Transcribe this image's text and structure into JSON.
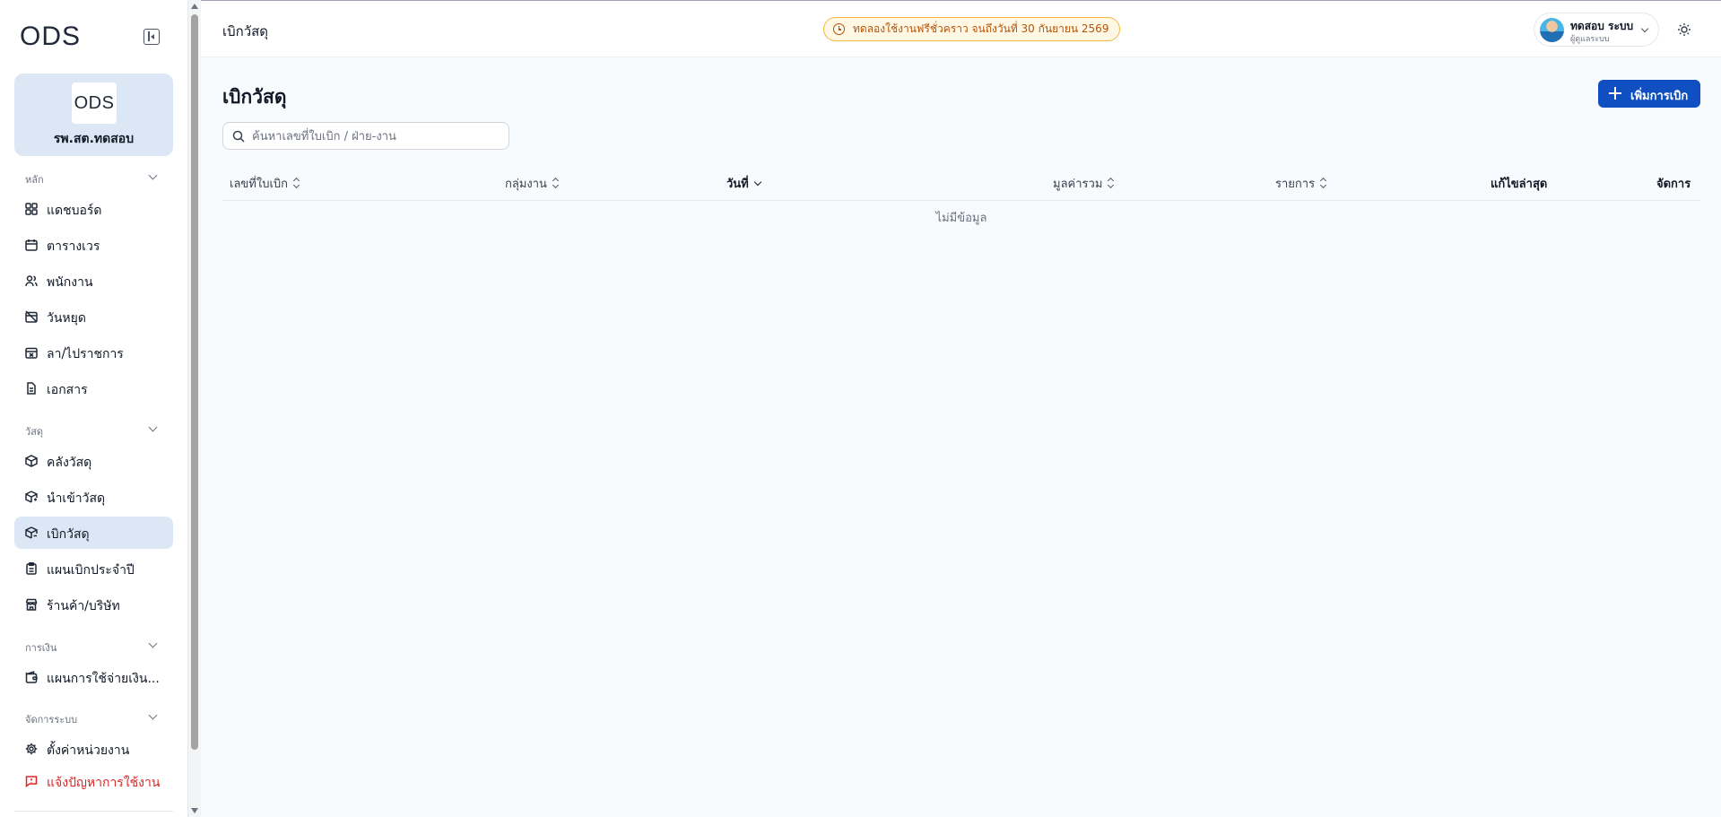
{
  "brand": {
    "logo_text": "ODS",
    "org_name": "รพ.สต.ทดสอบ"
  },
  "sidebar": {
    "sections": [
      {
        "title": "หลัก",
        "items": [
          {
            "label": "แดชบอร์ด",
            "icon": "dashboard-icon"
          },
          {
            "label": "ตารางเวร",
            "icon": "calendar-icon"
          },
          {
            "label": "พนักงาน",
            "icon": "users-icon"
          },
          {
            "label": "วันหยุด",
            "icon": "calendar-off-icon"
          },
          {
            "label": "ลา/ไปราชการ",
            "icon": "calendar-x-icon"
          },
          {
            "label": "เอกสาร",
            "icon": "document-icon"
          }
        ]
      },
      {
        "title": "วัสดุ",
        "items": [
          {
            "label": "คลังวัสดุ",
            "icon": "package-icon"
          },
          {
            "label": "นำเข้าวัสดุ",
            "icon": "package-import-icon"
          },
          {
            "label": "เบิกวัสดุ",
            "icon": "package-withdraw-icon",
            "active": true
          },
          {
            "label": "แผนเบิกประจำปี",
            "icon": "clipboard-icon"
          },
          {
            "label": "ร้านค้า/บริษัท",
            "icon": "store-icon"
          }
        ]
      },
      {
        "title": "การเงิน",
        "items": [
          {
            "label": "แผนการใช้จ่ายเงิน...",
            "icon": "wallet-icon"
          }
        ]
      },
      {
        "title": "จัดการระบบ",
        "items": [
          {
            "label": "ตั้งค่าหน่วยงาน",
            "icon": "settings-icon"
          },
          {
            "label": "แจ้งปัญหาการใช้งาน",
            "icon": "report-icon",
            "danger": true
          }
        ]
      }
    ]
  },
  "topbar": {
    "title": "เบิกวัสดุ",
    "trial_notice": "ทดลองใช้งานฟรีชั่วคราว จนถึงวันที่ 30 กันยายน 2569",
    "user_name": "ทดสอบ ระบบ",
    "user_role": "ผู้ดูแลระบบ"
  },
  "page": {
    "title": "เบิกวัสดุ",
    "add_button": "เพิ่มการเบิก",
    "search_placeholder": "ค้นหาเลขที่ใบเบิก / ฝ่าย-งาน",
    "search_value": ""
  },
  "table": {
    "columns": [
      "เลขที่ใบเบิก",
      "กลุ่มงาน",
      "วันที่",
      "มูลค่ารวม",
      "รายการ",
      "แก้ไขล่าสุด",
      "จัดการ"
    ],
    "sorted_column": "วันที่",
    "empty_text": "ไม่มีข้อมูล"
  },
  "colors": {
    "accent": "#0f4fc2",
    "active_nav": "#dbe7f4",
    "trial_border": "#f5b73c",
    "trial_text": "#b45309",
    "danger": "#dc2626"
  }
}
